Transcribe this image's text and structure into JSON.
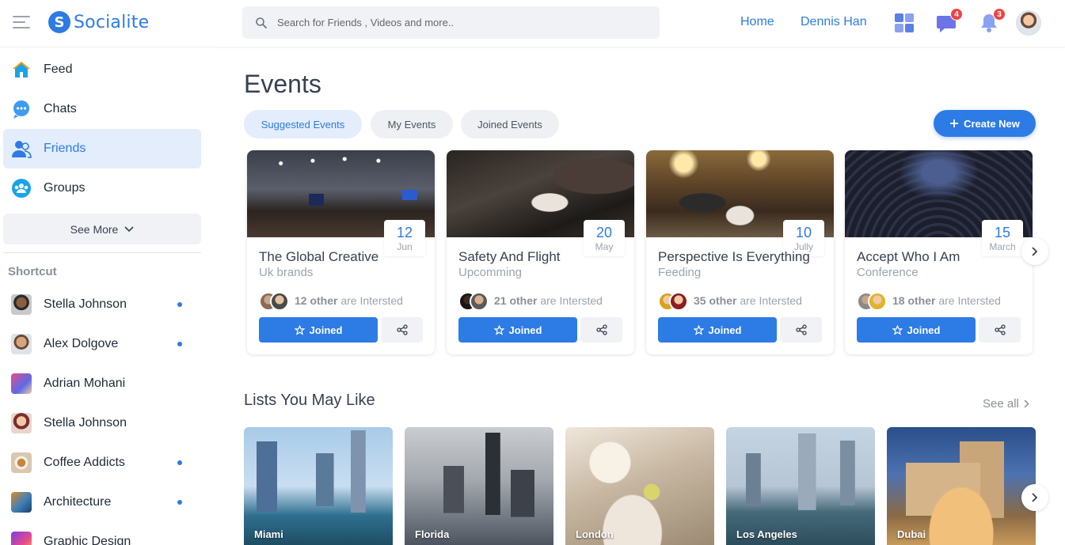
{
  "header": {
    "logo_letter": "S",
    "logo_text": "Socialite",
    "search_placeholder": "Search for Friends , Videos and more..",
    "nav": [
      "Home",
      "Dennis Han"
    ],
    "messages_badge": "4",
    "notifications_badge": "3",
    "accent": "#2d7be5"
  },
  "sidebar": {
    "items": [
      {
        "label": "Feed",
        "icon": "home-icon"
      },
      {
        "label": "Chats",
        "icon": "chat-icon"
      },
      {
        "label": "Friends",
        "icon": "friends-icon",
        "active": true
      },
      {
        "label": "Groups",
        "icon": "groups-icon"
      }
    ],
    "see_more": "See More",
    "shortcut_title": "Shortcut",
    "shortcuts": [
      {
        "name": "Stella Johnson",
        "online": true
      },
      {
        "name": "Alex Dolgove",
        "online": true
      },
      {
        "name": "Adrian Mohani",
        "online": false
      },
      {
        "name": "Stella Johnson",
        "online": false
      },
      {
        "name": "Coffee Addicts",
        "online": true
      },
      {
        "name": "Architecture",
        "online": true
      },
      {
        "name": "Graphic Design",
        "online": false
      }
    ]
  },
  "main": {
    "title": "Events",
    "tabs": [
      "Suggested Events",
      "My Events",
      "Joined Events"
    ],
    "create_label": "Create New",
    "events": [
      {
        "title": "The Global Creative",
        "subtitle": "Uk brands",
        "day": "12",
        "month": "Jun",
        "count": "12 other",
        "suffix": "are Intersted",
        "button": "Joined"
      },
      {
        "title": "Safety And Flight",
        "subtitle": "Upcomming",
        "day": "20",
        "month": "May",
        "count": "21 other",
        "suffix": "are Intersted",
        "button": "Joined"
      },
      {
        "title": "Perspective Is Everything",
        "subtitle": "Feeding",
        "day": "10",
        "month": "Jully",
        "count": "35 other",
        "suffix": "are Intersted",
        "button": "Joined"
      },
      {
        "title": "Accept Who I Am",
        "subtitle": "Conference",
        "day": "15",
        "month": "March",
        "count": "18 other",
        "suffix": "are Intersted",
        "button": "Joined"
      }
    ],
    "lists_title": "Lists You May Like",
    "see_all": "See all",
    "lists": [
      "Miami",
      "Florida",
      "London",
      "Los Angeles",
      "Dubai"
    ]
  }
}
